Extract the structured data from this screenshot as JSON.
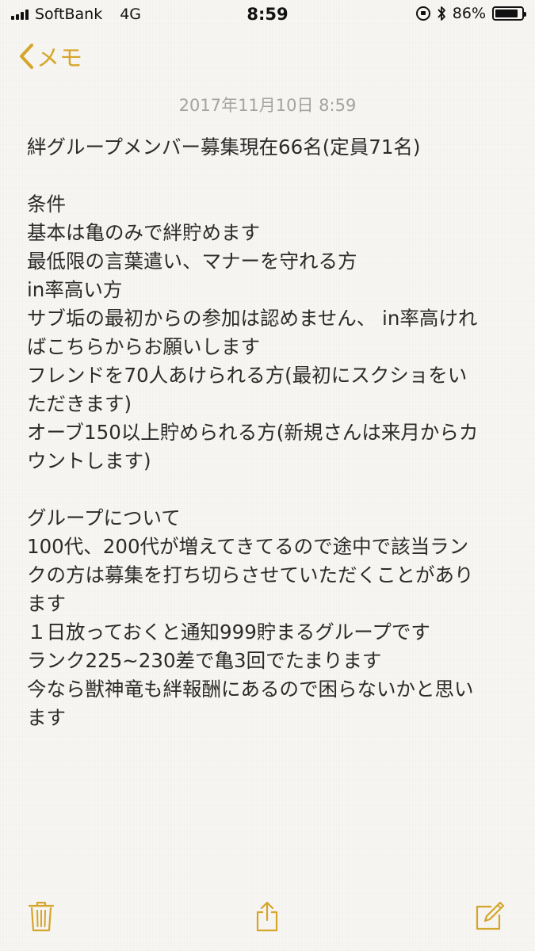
{
  "status_bar": {
    "carrier": "SoftBank",
    "network": "4G",
    "time": "8:59",
    "battery_text": "86%",
    "battery_level": 0.86
  },
  "nav": {
    "back_label": "メモ"
  },
  "note": {
    "date": "2017年11月10日 8:59",
    "lines": [
      "絆グループメンバー募集現在66名(定員71名)",
      "",
      "条件",
      "基本は亀のみで絆貯めます",
      "最低限の言葉遣い、マナーを守れる方",
      "in率高い方",
      "サブ垢の最初からの参加は認めません、 in率高けれ",
      "ばこちらからお願いします",
      "フレンドを70人あけられる方(最初にスクショをい",
      "ただきます)",
      "オーブ150以上貯められる方(新規さんは来月からカ",
      "ウントします)",
      "",
      "グループについて",
      "100代、200代が増えてきてるので途中で該当ラン",
      "クの方は募集を打ち切らさせていただくことがあり",
      "ます",
      "１日放っておくと通知999貯まるグループです",
      "ランク225~230差で亀3回でたまります",
      "今なら獣神竜も絆報酬にあるので困らないかと思い",
      "ます"
    ]
  },
  "toolbar": {
    "icons": [
      "trash-icon",
      "share-icon",
      "compose-icon"
    ]
  },
  "colors": {
    "accent": "#d6a52b",
    "background": "#f7f6f2",
    "date_text": "#a3a3a3",
    "body_text": "#2b2b2b"
  }
}
